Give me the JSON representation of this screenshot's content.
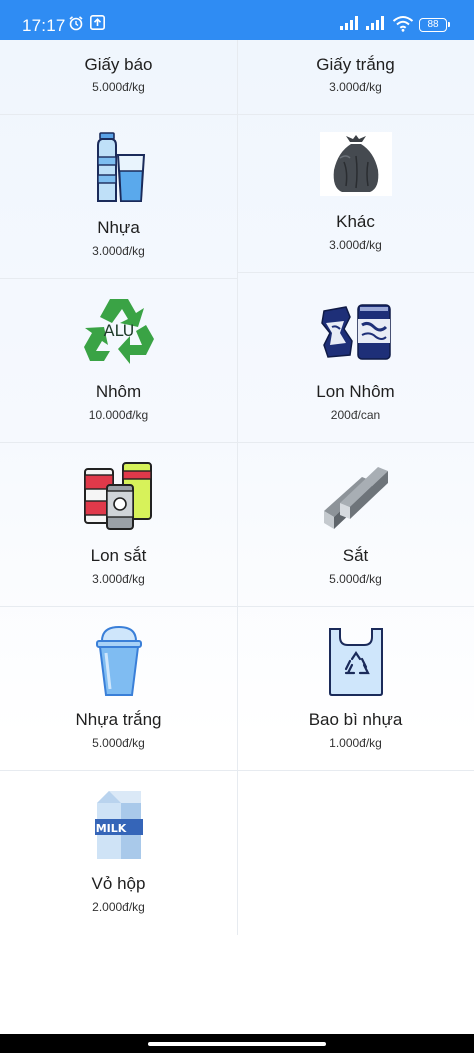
{
  "status_bar": {
    "time": "17:17",
    "battery": "88"
  },
  "items": [
    {
      "name": "Giấy báo",
      "price": "5.000đ/kg",
      "icon": "newspaper-icon"
    },
    {
      "name": "Giấy trắng",
      "price": "3.000đ/kg",
      "icon": "white-paper-icon"
    },
    {
      "name": "Nhựa",
      "price": "3.000đ/kg",
      "icon": "plastic-bottle-icon"
    },
    {
      "name": "Khác",
      "price": "3.000đ/kg",
      "icon": "garbage-bag-icon"
    },
    {
      "name": "Nhôm",
      "price": "10.000đ/kg",
      "icon": "aluminium-recycle-icon",
      "icon_text": "ALU"
    },
    {
      "name": "Lon Nhôm",
      "price": "200đ/can",
      "icon": "aluminium-can-icon"
    },
    {
      "name": "Lon sắt",
      "price": "3.000đ/kg",
      "icon": "iron-can-icon"
    },
    {
      "name": "Sắt",
      "price": "5.000đ/kg",
      "icon": "steel-beam-icon"
    },
    {
      "name": "Nhựa trắng",
      "price": "5.000đ/kg",
      "icon": "plastic-cup-icon"
    },
    {
      "name": "Bao bì nhựa",
      "price": "1.000đ/kg",
      "icon": "plastic-bag-icon"
    },
    {
      "name": "Vỏ hộp",
      "price": "2.000đ/kg",
      "icon": "milk-carton-icon",
      "icon_text": "MILK"
    }
  ],
  "colors": {
    "status_bar": "#2f8cf3",
    "recycle_green": "#3aa345",
    "navy": "#1d2f6f"
  }
}
